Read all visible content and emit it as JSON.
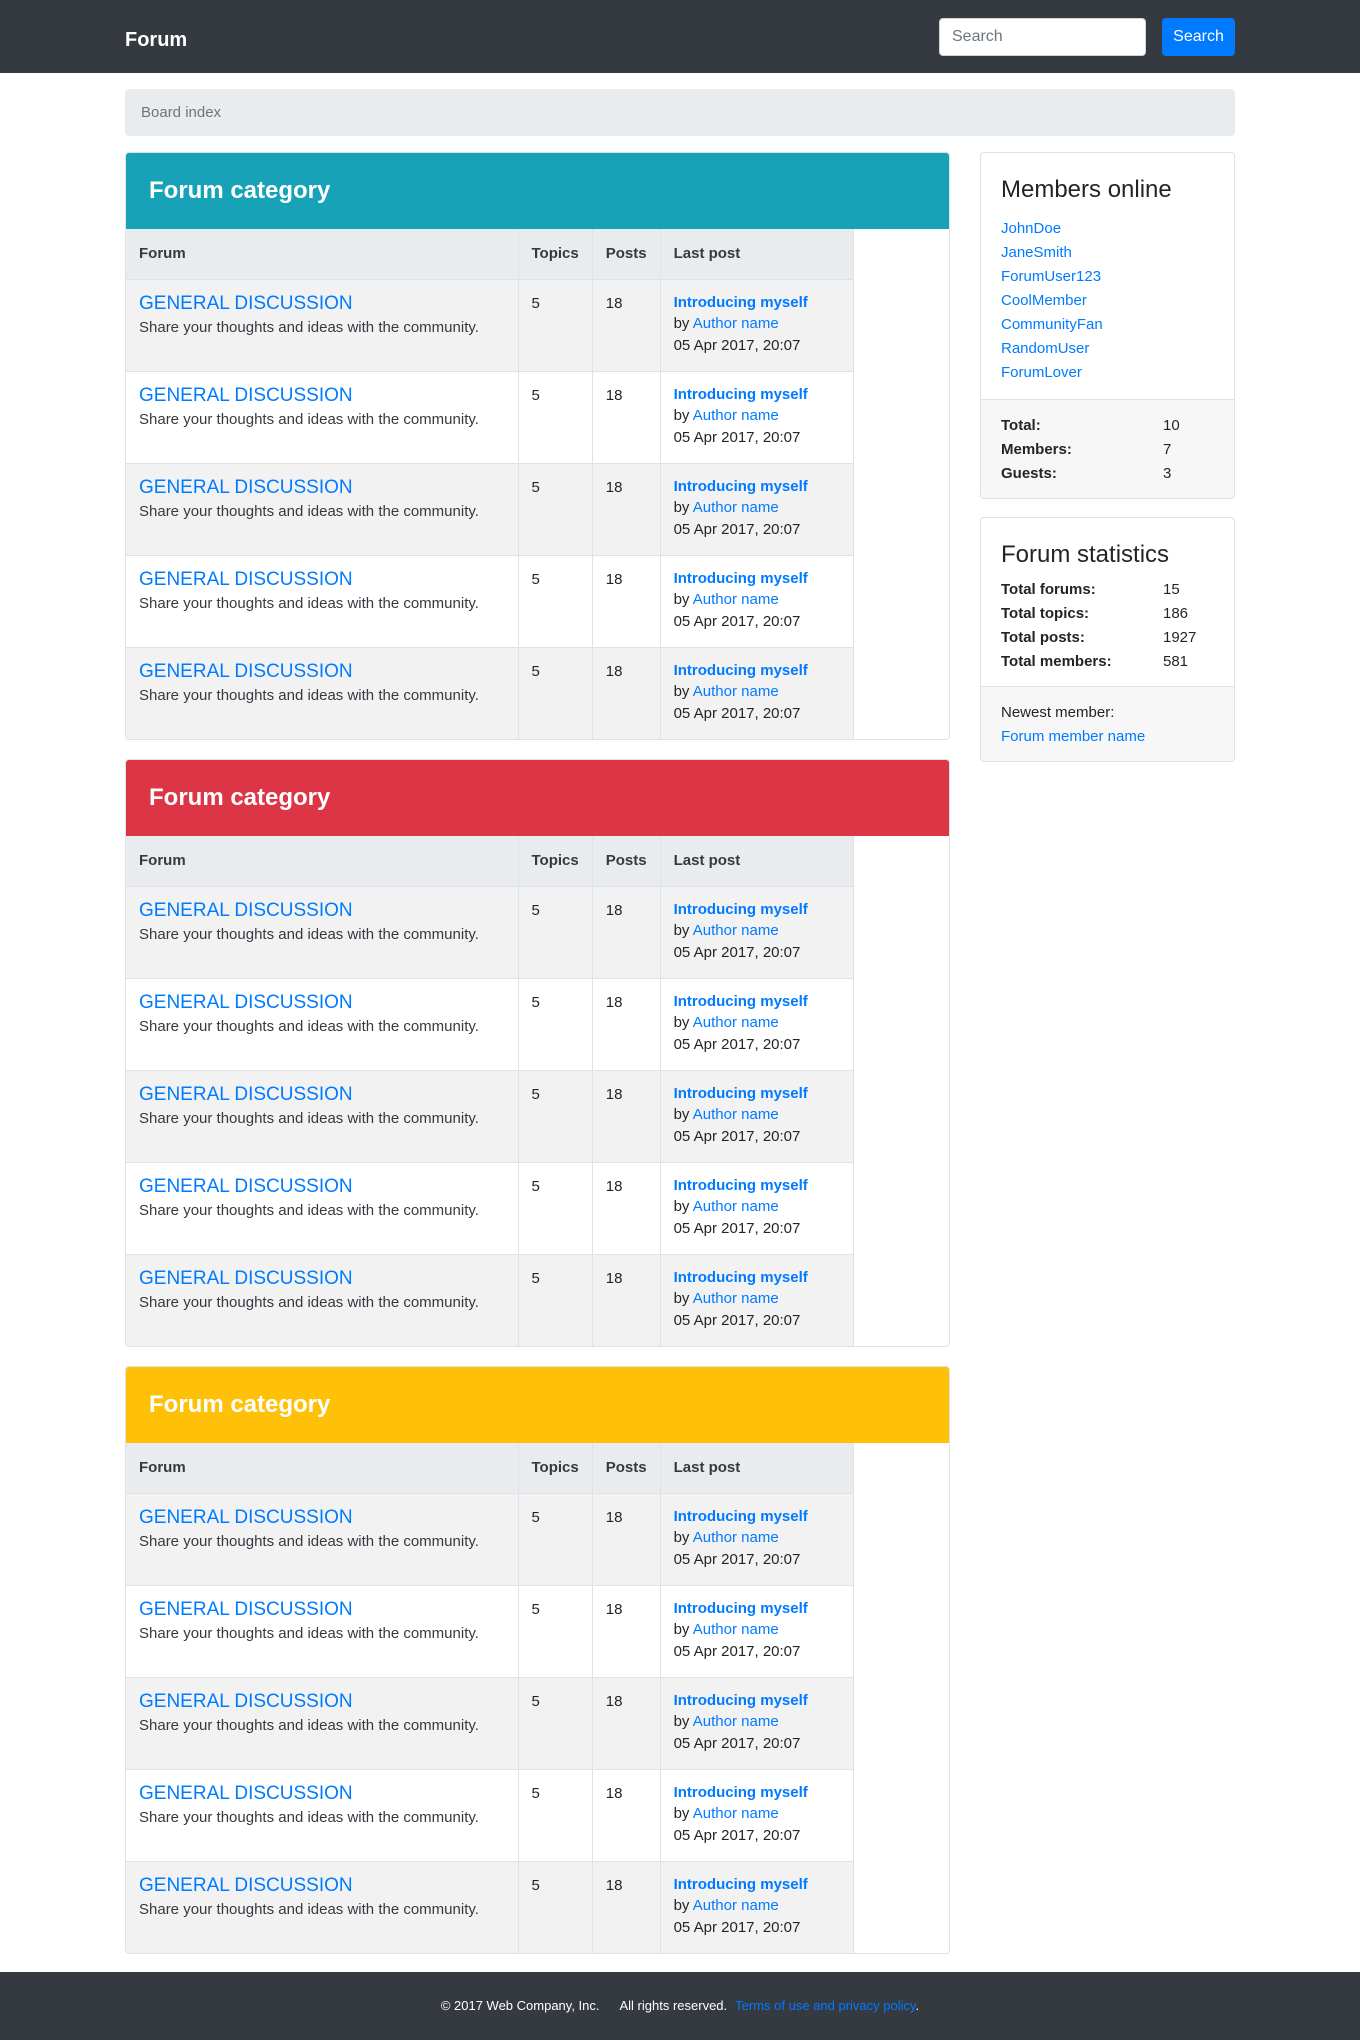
{
  "navbar": {
    "brand": "Forum",
    "search_placeholder": "Search",
    "search_button": "Search"
  },
  "breadcrumb": {
    "label": "Board index"
  },
  "colors": {
    "cat1": "#17a2b8",
    "cat2": "#dc3545",
    "cat3": "#ffc107",
    "link": "#007bff",
    "dark": "#343a40"
  },
  "table_headers": {
    "forum": "Forum",
    "topics": "Topics",
    "posts": "Posts",
    "last_post": "Last post"
  },
  "categories": [
    {
      "title": "Forum category",
      "rows": [
        {
          "forum": "GENERAL DISCUSSION",
          "desc": "Share your thoughts and ideas with the community.",
          "topics": "5",
          "posts": "18",
          "post_title": "Introducing myself",
          "by": "by",
          "author": "Author name",
          "date": "05 Apr 2017, 20:07"
        },
        {
          "forum": "GENERAL DISCUSSION",
          "desc": "Share your thoughts and ideas with the community.",
          "topics": "5",
          "posts": "18",
          "post_title": "Introducing myself",
          "by": "by",
          "author": "Author name",
          "date": "05 Apr 2017, 20:07"
        },
        {
          "forum": "GENERAL DISCUSSION",
          "desc": "Share your thoughts and ideas with the community.",
          "topics": "5",
          "posts": "18",
          "post_title": "Introducing myself",
          "by": "by",
          "author": "Author name",
          "date": "05 Apr 2017, 20:07"
        },
        {
          "forum": "GENERAL DISCUSSION",
          "desc": "Share your thoughts and ideas with the community.",
          "topics": "5",
          "posts": "18",
          "post_title": "Introducing myself",
          "by": "by",
          "author": "Author name",
          "date": "05 Apr 2017, 20:07"
        },
        {
          "forum": "GENERAL DISCUSSION",
          "desc": "Share your thoughts and ideas with the community.",
          "topics": "5",
          "posts": "18",
          "post_title": "Introducing myself",
          "by": "by",
          "author": "Author name",
          "date": "05 Apr 2017, 20:07"
        }
      ]
    },
    {
      "title": "Forum category",
      "rows": [
        {
          "forum": "GENERAL DISCUSSION",
          "desc": "Share your thoughts and ideas with the community.",
          "topics": "5",
          "posts": "18",
          "post_title": "Introducing myself",
          "by": "by",
          "author": "Author name",
          "date": "05 Apr 2017, 20:07"
        },
        {
          "forum": "GENERAL DISCUSSION",
          "desc": "Share your thoughts and ideas with the community.",
          "topics": "5",
          "posts": "18",
          "post_title": "Introducing myself",
          "by": "by",
          "author": "Author name",
          "date": "05 Apr 2017, 20:07"
        },
        {
          "forum": "GENERAL DISCUSSION",
          "desc": "Share your thoughts and ideas with the community.",
          "topics": "5",
          "posts": "18",
          "post_title": "Introducing myself",
          "by": "by",
          "author": "Author name",
          "date": "05 Apr 2017, 20:07"
        },
        {
          "forum": "GENERAL DISCUSSION",
          "desc": "Share your thoughts and ideas with the community.",
          "topics": "5",
          "posts": "18",
          "post_title": "Introducing myself",
          "by": "by",
          "author": "Author name",
          "date": "05 Apr 2017, 20:07"
        },
        {
          "forum": "GENERAL DISCUSSION",
          "desc": "Share your thoughts and ideas with the community.",
          "topics": "5",
          "posts": "18",
          "post_title": "Introducing myself",
          "by": "by",
          "author": "Author name",
          "date": "05 Apr 2017, 20:07"
        }
      ]
    },
    {
      "title": "Forum category",
      "rows": [
        {
          "forum": "GENERAL DISCUSSION",
          "desc": "Share your thoughts and ideas with the community.",
          "topics": "5",
          "posts": "18",
          "post_title": "Introducing myself",
          "by": "by",
          "author": "Author name",
          "date": "05 Apr 2017, 20:07"
        },
        {
          "forum": "GENERAL DISCUSSION",
          "desc": "Share your thoughts and ideas with the community.",
          "topics": "5",
          "posts": "18",
          "post_title": "Introducing myself",
          "by": "by",
          "author": "Author name",
          "date": "05 Apr 2017, 20:07"
        },
        {
          "forum": "GENERAL DISCUSSION",
          "desc": "Share your thoughts and ideas with the community.",
          "topics": "5",
          "posts": "18",
          "post_title": "Introducing myself",
          "by": "by",
          "author": "Author name",
          "date": "05 Apr 2017, 20:07"
        },
        {
          "forum": "GENERAL DISCUSSION",
          "desc": "Share your thoughts and ideas with the community.",
          "topics": "5",
          "posts": "18",
          "post_title": "Introducing myself",
          "by": "by",
          "author": "Author name",
          "date": "05 Apr 2017, 20:07"
        },
        {
          "forum": "GENERAL DISCUSSION",
          "desc": "Share your thoughts and ideas with the community.",
          "topics": "5",
          "posts": "18",
          "post_title": "Introducing myself",
          "by": "by",
          "author": "Author name",
          "date": "05 Apr 2017, 20:07"
        }
      ]
    }
  ],
  "members_online": {
    "title": "Members online",
    "members": [
      "JohnDoe",
      "JaneSmith",
      "ForumUser123",
      "CoolMember",
      "CommunityFan",
      "RandomUser",
      "ForumLover"
    ],
    "stats": [
      {
        "label": "Total:",
        "value": "10"
      },
      {
        "label": "Members:",
        "value": "7"
      },
      {
        "label": "Guests:",
        "value": "3"
      }
    ]
  },
  "forum_statistics": {
    "title": "Forum statistics",
    "stats": [
      {
        "label": "Total forums:",
        "value": "15"
      },
      {
        "label": "Total topics:",
        "value": "186"
      },
      {
        "label": "Total posts:",
        "value": "1927"
      },
      {
        "label": "Total members:",
        "value": "581"
      }
    ],
    "newest_label": "Newest member:",
    "newest_name": "Forum member name"
  },
  "footer": {
    "copyright": "© 2017 Web Company, Inc.",
    "rights": "All rights reserved.",
    "terms": "Terms of use and privacy policy",
    "period": "."
  }
}
